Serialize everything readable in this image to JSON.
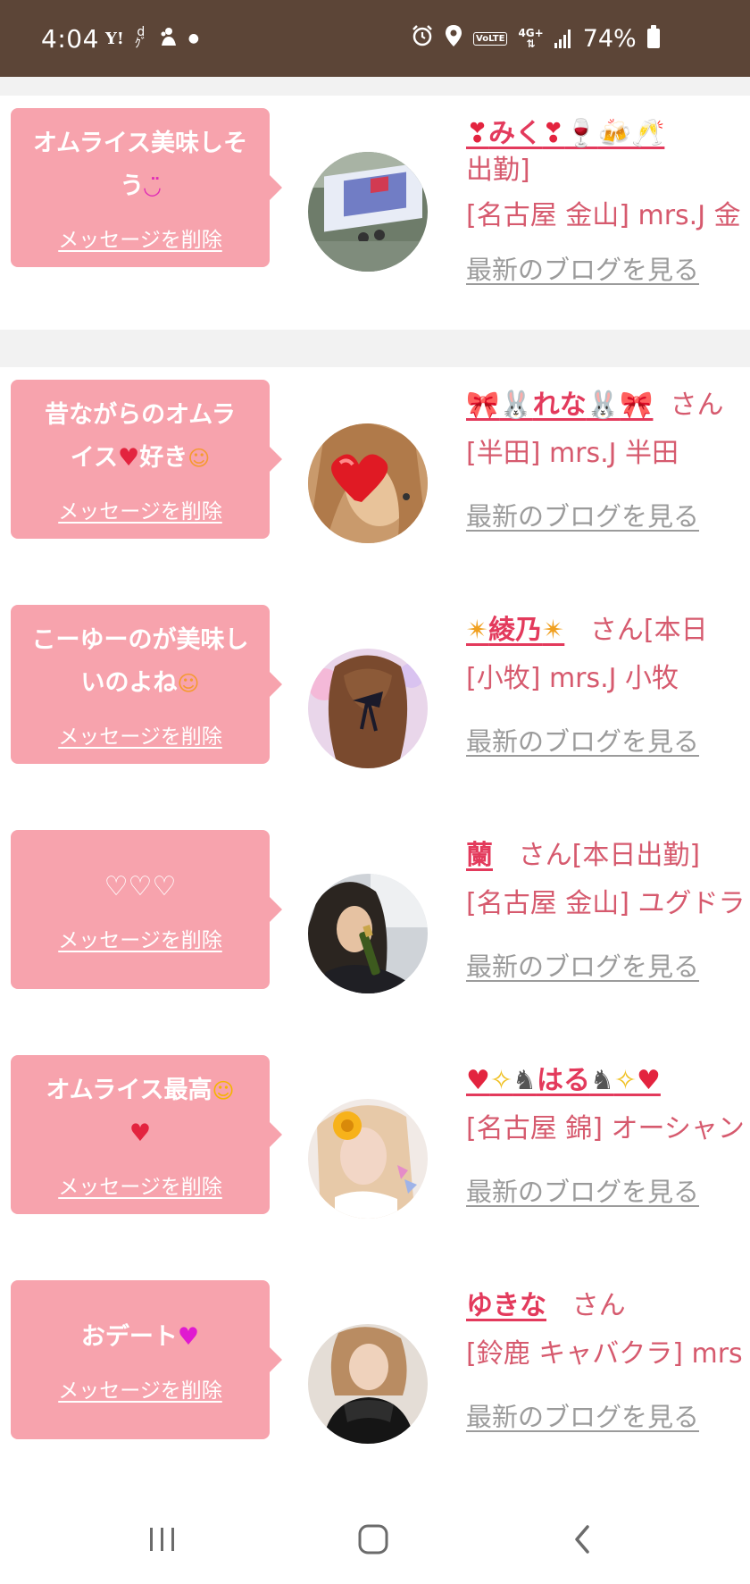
{
  "status_bar": {
    "time": "4:04",
    "battery": "74%",
    "left_icons": [
      "yahoo-icon",
      "d-menu-icon",
      "app-notification-icon",
      "dot-icon"
    ],
    "right_icons": [
      "alarm-icon",
      "location-icon",
      "volte-icon",
      "4g-plus-icon",
      "signal-icon",
      "battery-icon"
    ],
    "volte_label": "VoLTE",
    "network_label": "4G+"
  },
  "items": [
    {
      "message": "オムライス美味しそう",
      "delete_label": "メッセージを削除",
      "name": "みく",
      "name_suffix": "出勤]",
      "shop": "[名古屋 金山] mrs.J 金",
      "blog_label": "最新のブログを見る"
    },
    {
      "message_a": "昔ながらのオムラ",
      "message_b": "イス",
      "message_c": "好き",
      "delete_label": "メッセージを削除",
      "name": "れな",
      "name_suffix": "さん",
      "shop": "[半田] mrs.J 半田",
      "blog_label": "最新のブログを見る"
    },
    {
      "message": "こーゆーのが美味しいのよね",
      "delete_label": "メッセージを削除",
      "name": "綾乃",
      "name_suffix": "さん[本日",
      "shop": "[小牧] mrs.J 小牧",
      "blog_label": "最新のブログを見る"
    },
    {
      "message": "♡♡♡",
      "delete_label": "メッセージを削除",
      "name": "蘭",
      "name_suffix": "さん[本日出勤]",
      "shop": "[名古屋 金山] ユグドラ",
      "blog_label": "最新のブログを見る"
    },
    {
      "message": "オムライス最高",
      "delete_label": "メッセージを削除",
      "name": "はる",
      "name_suffix": "",
      "shop": "[名古屋 錦] オーシャン",
      "blog_label": "最新のブログを見る"
    },
    {
      "message": "おデート",
      "delete_label": "メッセージを削除",
      "name": "ゆきな",
      "name_suffix": "さん",
      "shop": "[鈴鹿 キャバクラ] mrs",
      "blog_label": "最新のブログを見る"
    }
  ],
  "nav": {
    "icons": [
      "recent-apps-icon",
      "home-icon",
      "back-icon"
    ]
  },
  "colors": {
    "status_bar": "#5c4537",
    "bubble": "#f7a3ad",
    "name_link": "#e33a5c",
    "text_pink": "#d65a6e",
    "blog_link": "#9b9b9b",
    "page_bg": "#f2f2f2"
  }
}
